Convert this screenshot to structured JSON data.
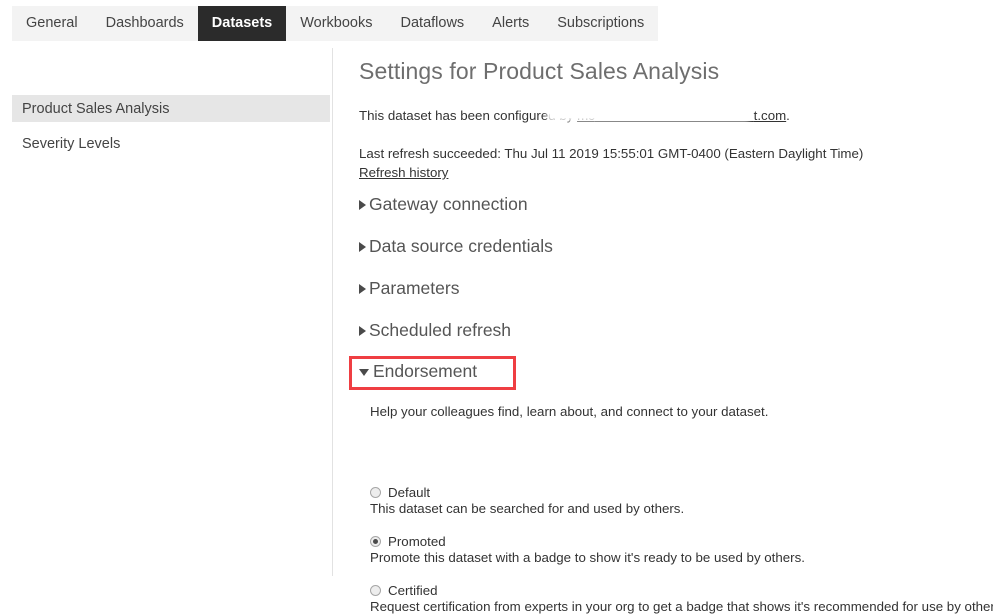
{
  "tabs": [
    {
      "label": "General",
      "active": false
    },
    {
      "label": "Dashboards",
      "active": false
    },
    {
      "label": "Datasets",
      "active": true
    },
    {
      "label": "Workbooks",
      "active": false
    },
    {
      "label": "Dataflows",
      "active": false
    },
    {
      "label": "Alerts",
      "active": false
    },
    {
      "label": "Subscriptions",
      "active": false
    }
  ],
  "sidebar": {
    "items": [
      {
        "label": "Product Sales Analysis",
        "selected": true
      },
      {
        "label": "Severity Levels",
        "selected": false
      }
    ]
  },
  "main": {
    "title": "Settings for Product Sales Analysis",
    "configured_prefix": "This dataset has been configured by ",
    "configured_email_visible_start": "mc",
    "configured_email_visible_end": "t.com",
    "configured_suffix": ".",
    "last_refresh": "Last refresh succeeded: Thu Jul 11 2019 15:55:01 GMT-0400 (Eastern Daylight Time)",
    "refresh_history_link": "Refresh history",
    "sections": [
      {
        "label": "Gateway connection",
        "expanded": false,
        "icon": "triangle-right-icon"
      },
      {
        "label": "Data source credentials",
        "expanded": false,
        "icon": "triangle-right-icon"
      },
      {
        "label": "Parameters",
        "expanded": false,
        "icon": "triangle-right-icon"
      },
      {
        "label": "Scheduled refresh",
        "expanded": false,
        "icon": "triangle-right-icon"
      }
    ],
    "endorsement": {
      "label": "Endorsement",
      "expanded": true,
      "icon": "triangle-down-icon",
      "highlight_color": "#ef3e42",
      "help_text": "Help your colleagues find, learn about, and connect to your dataset.",
      "options": [
        {
          "label": "Default",
          "description": "This dataset can be searched for and used by others.",
          "selected": false
        },
        {
          "label": "Promoted",
          "description": "Promote this dataset with a badge to show it's ready to be used by others.",
          "selected": true
        },
        {
          "label": "Certified",
          "description": "Request certification from experts in your org to get a badge that shows it's recommended for use by others",
          "selected": false
        }
      ]
    }
  },
  "colors": {
    "active_tab_bg": "#2b2b2b",
    "tabbar_bg": "#f3f3f3",
    "sidebar_selected_bg": "#e6e6e6",
    "accent_red": "#ef3e42",
    "title_gray": "#6e6e6e"
  }
}
